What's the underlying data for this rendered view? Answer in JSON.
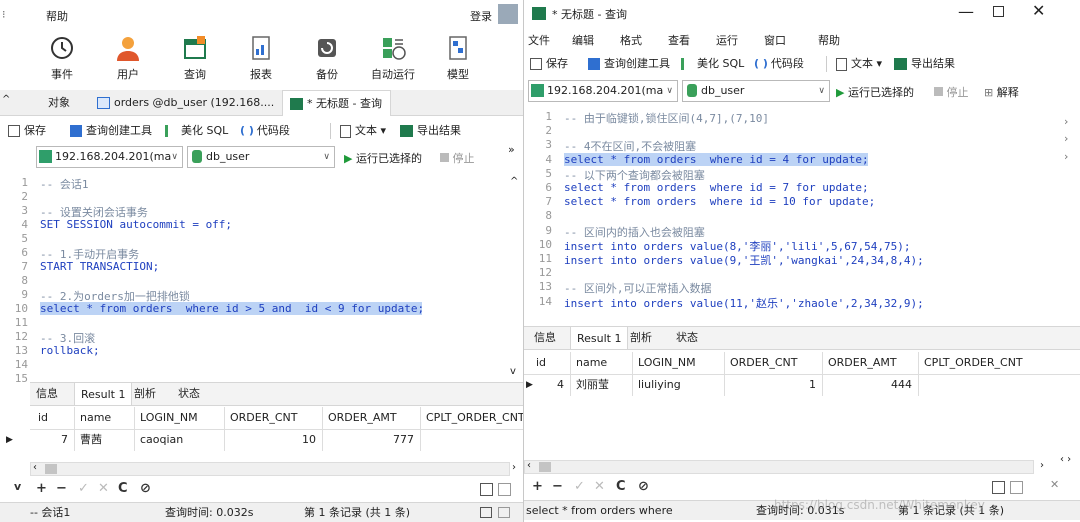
{
  "left": {
    "menu": {
      "help": "帮助",
      "login": "登录"
    },
    "toolbar": [
      {
        "label": "事件",
        "icon": "clock-icon"
      },
      {
        "label": "用户",
        "icon": "user-icon"
      },
      {
        "label": "查询",
        "icon": "query-icon"
      },
      {
        "label": "报表",
        "icon": "report-icon"
      },
      {
        "label": "备份",
        "icon": "backup-icon"
      },
      {
        "label": "自动运行",
        "icon": "autorun-icon"
      },
      {
        "label": "模型",
        "icon": "model-icon"
      }
    ],
    "tabs": {
      "objects": "对象",
      "table": "orders @db_user (192.168....",
      "query": "* 无标题 - 查询"
    },
    "query_toolbar": {
      "save": "保存",
      "builder": "查询创建工具",
      "beautify": "美化 SQL",
      "snippet": "代码段",
      "text": "文本",
      "export": "导出结果"
    },
    "conn": {
      "host": "192.168.204.201(ma",
      "db": "db_user",
      "run": "运行已选择的",
      "stop": "停止"
    },
    "code": [
      {
        "n": "1",
        "t": "-- 会话1"
      },
      {
        "n": "2",
        "t": ""
      },
      {
        "n": "3",
        "t": "-- 设置关闭会话事务"
      },
      {
        "n": "4",
        "t": "SET SESSION autocommit = off;"
      },
      {
        "n": "5",
        "t": ""
      },
      {
        "n": "6",
        "t": "-- 1.手动开启事务"
      },
      {
        "n": "7",
        "t": "START TRANSACTION;"
      },
      {
        "n": "8",
        "t": ""
      },
      {
        "n": "9",
        "t": "-- 2.为orders加一把排他锁"
      },
      {
        "n": "10",
        "t": "select * from orders  where id > 5 and  id < 9 for update;"
      },
      {
        "n": "11",
        "t": ""
      },
      {
        "n": "12",
        "t": "-- 3.回滚"
      },
      {
        "n": "13",
        "t": "rollback;"
      },
      {
        "n": "14",
        "t": ""
      },
      {
        "n": "15",
        "t": ""
      }
    ],
    "result_tabs": {
      "info": "信息",
      "result": "Result 1",
      "profile": "剖析",
      "status": "状态"
    },
    "columns": [
      "id",
      "name",
      "LOGIN_NM",
      "ORDER_CNT",
      "ORDER_AMT",
      "CPLT_ORDER_CNT"
    ],
    "rows": [
      [
        "7",
        "曹茜",
        "caoqian",
        "10",
        "777",
        ""
      ]
    ],
    "status": {
      "session": "-- 会话1",
      "time": "查询时间: 0.032s",
      "records": "第 1 条记录 (共 1 条)"
    }
  },
  "right": {
    "title": "* 无标题 - 查询",
    "menu": [
      "文件",
      "编辑",
      "格式",
      "查看",
      "运行",
      "窗口",
      "帮助"
    ],
    "query_toolbar": {
      "save": "保存",
      "builder": "查询创建工具",
      "beautify": "美化 SQL",
      "snippet": "代码段",
      "text": "文本",
      "export": "导出结果"
    },
    "conn": {
      "host": "192.168.204.201(ma",
      "db": "db_user",
      "run": "运行已选择的",
      "stop": "停止",
      "explain": "解释"
    },
    "code": [
      {
        "n": "1",
        "t": "-- 由于临键锁,锁住区间(4,7],(7,10]"
      },
      {
        "n": "2",
        "t": ""
      },
      {
        "n": "3",
        "t": "-- 4不在区间,不会被阻塞"
      },
      {
        "n": "4",
        "t": "select * from orders  where id = 4 for update;"
      },
      {
        "n": "5",
        "t": "-- 以下两个查询都会被阻塞"
      },
      {
        "n": "6",
        "t": "select * from orders  where id = 7 for update;"
      },
      {
        "n": "7",
        "t": "select * from orders  where id = 10 for update;"
      },
      {
        "n": "8",
        "t": ""
      },
      {
        "n": "9",
        "t": "-- 区间内的插入也会被阻塞"
      },
      {
        "n": "10",
        "t": "insert into orders value(8,'李丽','lili',5,67,54,75);"
      },
      {
        "n": "11",
        "t": "insert into orders value(9,'王凯','wangkai',24,34,8,4);"
      },
      {
        "n": "12",
        "t": ""
      },
      {
        "n": "13",
        "t": "-- 区间外,可以正常插入数据"
      },
      {
        "n": "14",
        "t": "insert into orders value(11,'赵乐','zhaole',2,34,32,9);"
      }
    ],
    "result_tabs": {
      "info": "信息",
      "result": "Result 1",
      "profile": "剖析",
      "status": "状态"
    },
    "columns": [
      "id",
      "name",
      "LOGIN_NM",
      "ORDER_CNT",
      "ORDER_AMT",
      "CPLT_ORDER_CNT"
    ],
    "rows": [
      [
        "4",
        "刘丽莹",
        "liuliying",
        "1",
        "444",
        ""
      ]
    ],
    "status": {
      "sql": "select * from orders  where",
      "time": "查询时间: 0.031s",
      "records": "第 1 条记录 (共 1 条)"
    },
    "watermark": "https://blog.csdn.net/Whitemonkey"
  }
}
